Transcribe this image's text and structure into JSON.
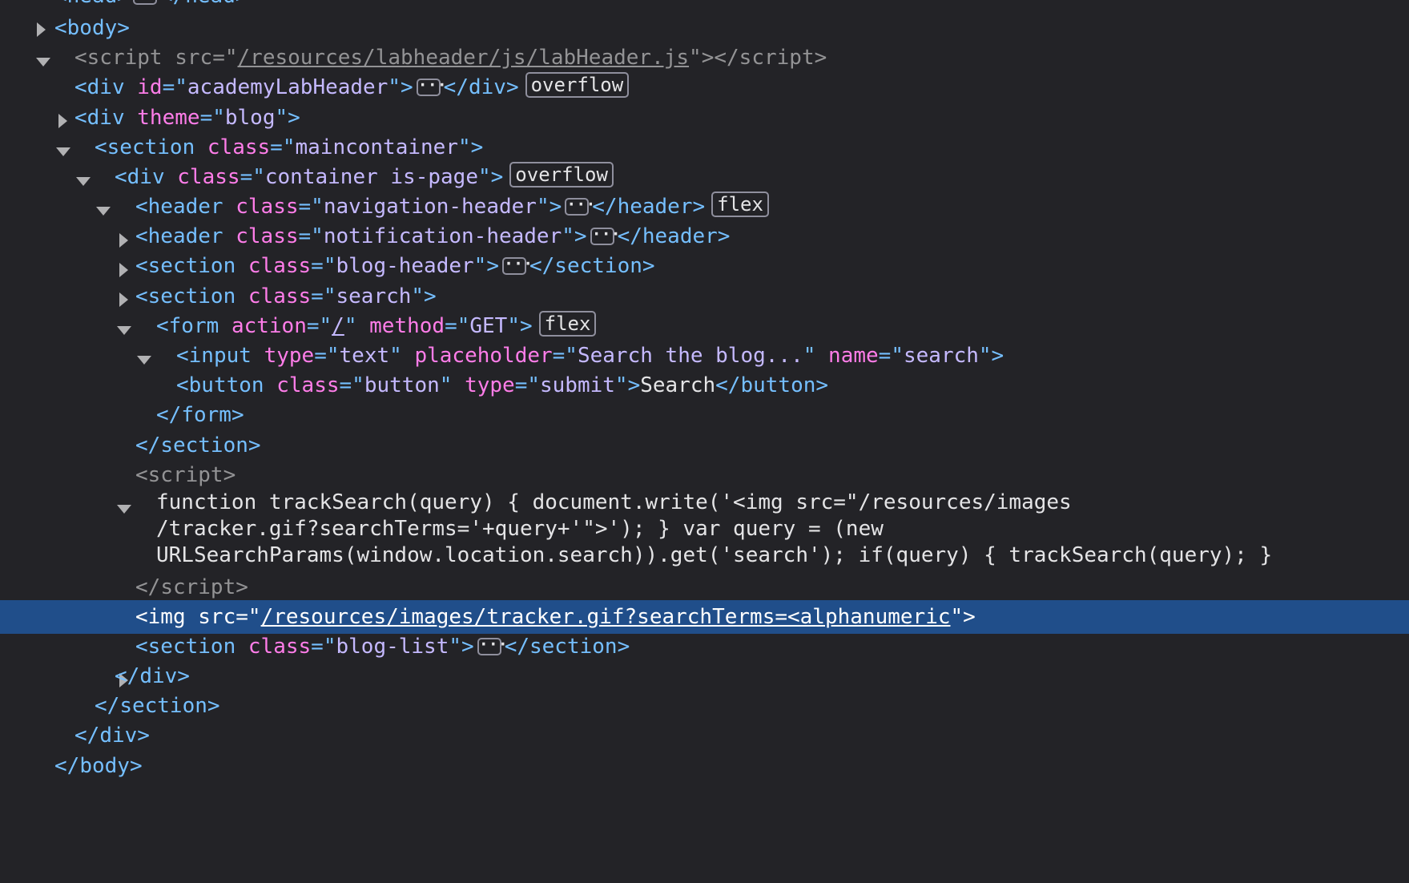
{
  "partial_top_row": {
    "text": "<head>",
    "end": "</head>"
  },
  "nodes": {
    "body_open": {
      "tag": "body"
    },
    "script_labheader": {
      "tag": "script",
      "attr": "src",
      "value": "/resources/labheader/js/labHeader.js"
    },
    "div_academy": {
      "tag": "div",
      "attr": "id",
      "value": "academyLabHeader",
      "badge": "overflow"
    },
    "div_theme": {
      "tag": "div",
      "attr": "theme",
      "value": "blog"
    },
    "section_main": {
      "tag": "section",
      "attr": "class",
      "value": "maincontainer"
    },
    "div_container": {
      "tag": "div",
      "attr": "class",
      "value": "container is-page",
      "badge": "overflow"
    },
    "header_nav": {
      "tag": "header",
      "attr": "class",
      "value": "navigation-header",
      "badge": "flex"
    },
    "header_notif": {
      "tag": "header",
      "attr": "class",
      "value": "notification-header"
    },
    "section_blog_header": {
      "tag": "section",
      "attr": "class",
      "value": "blog-header"
    },
    "section_search": {
      "tag": "section",
      "attr": "class",
      "value": "search"
    },
    "form": {
      "tag": "form",
      "attr1": "action",
      "value1": "/",
      "attr2": "method",
      "value2": "GET",
      "badge": "flex"
    },
    "input": {
      "tag": "input",
      "attr1": "type",
      "value1": "text",
      "attr2": "placeholder",
      "value2": "Search the blog...",
      "attr3": "name",
      "value3": "search"
    },
    "button": {
      "tag": "button",
      "attr1": "class",
      "value1": "button",
      "attr2": "type",
      "value2": "submit",
      "text": "Search"
    },
    "form_close": {
      "tag": "form"
    },
    "section_search_close": {
      "tag": "section"
    },
    "script_inline": {
      "tag": "script",
      "code_lines": [
        "function trackSearch(query) { document.write('<img src=\"/resources/images",
        "/tracker.gif?searchTerms='+query+'\">'); } var query = (new",
        "URLSearchParams(window.location.search)).get('search'); if(query) { trackSearch(query); }"
      ]
    },
    "script_inline_close": {
      "tag": "script"
    },
    "img_tracker": {
      "tag": "img",
      "attr": "src",
      "value": "/resources/images/tracker.gif?searchTerms=<alphanumeric"
    },
    "section_blog_list": {
      "tag": "section",
      "attr": "class",
      "value": "blog-list"
    },
    "div_container_close": {
      "tag": "div"
    },
    "section_main_close": {
      "tag": "section"
    },
    "div_theme_close": {
      "tag": "div"
    },
    "body_close": {
      "tag": "body"
    }
  },
  "ellipsis_glyph": "···",
  "colors": {
    "background": "#232327",
    "selection": "#204e8a",
    "tag": "#75bfff",
    "attribute": "#ff7de9",
    "value": "#c5b9ff",
    "text": "#e4e4e6"
  }
}
